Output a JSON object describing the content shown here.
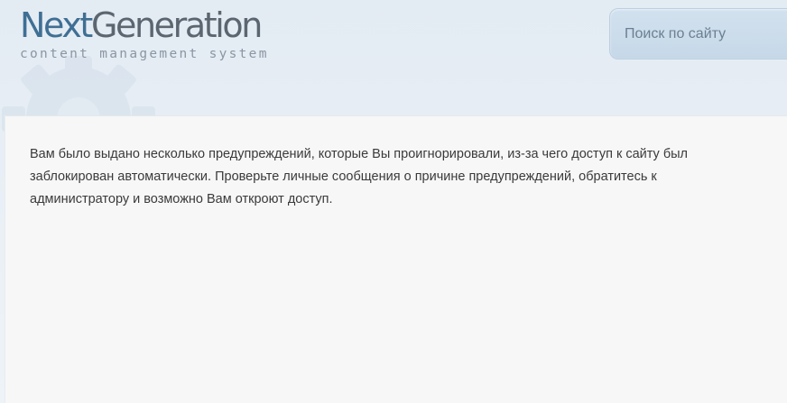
{
  "header": {
    "logo": {
      "part1": "Next",
      "part2": "Generation",
      "tagline": "content management system"
    },
    "search": {
      "placeholder": "Поиск по сайту",
      "value": ""
    }
  },
  "main": {
    "message": "Вам было выдано несколько предупреждений, которые Вы проигнорировали, из-за чего доступ к сайту был заблокирован автоматически. Проверьте личные сообщения о причине предупреждений, обратитесь к администратору и возможно Вам откроют доступ."
  },
  "colors": {
    "logo_accent": "#3f6f94",
    "logo_dark": "#5b6670",
    "page_background": "#e7eef5",
    "panel_background": "#f7f7f7",
    "text": "#3a3a3a"
  },
  "icons": {
    "background_decoration": "gear-icon"
  }
}
